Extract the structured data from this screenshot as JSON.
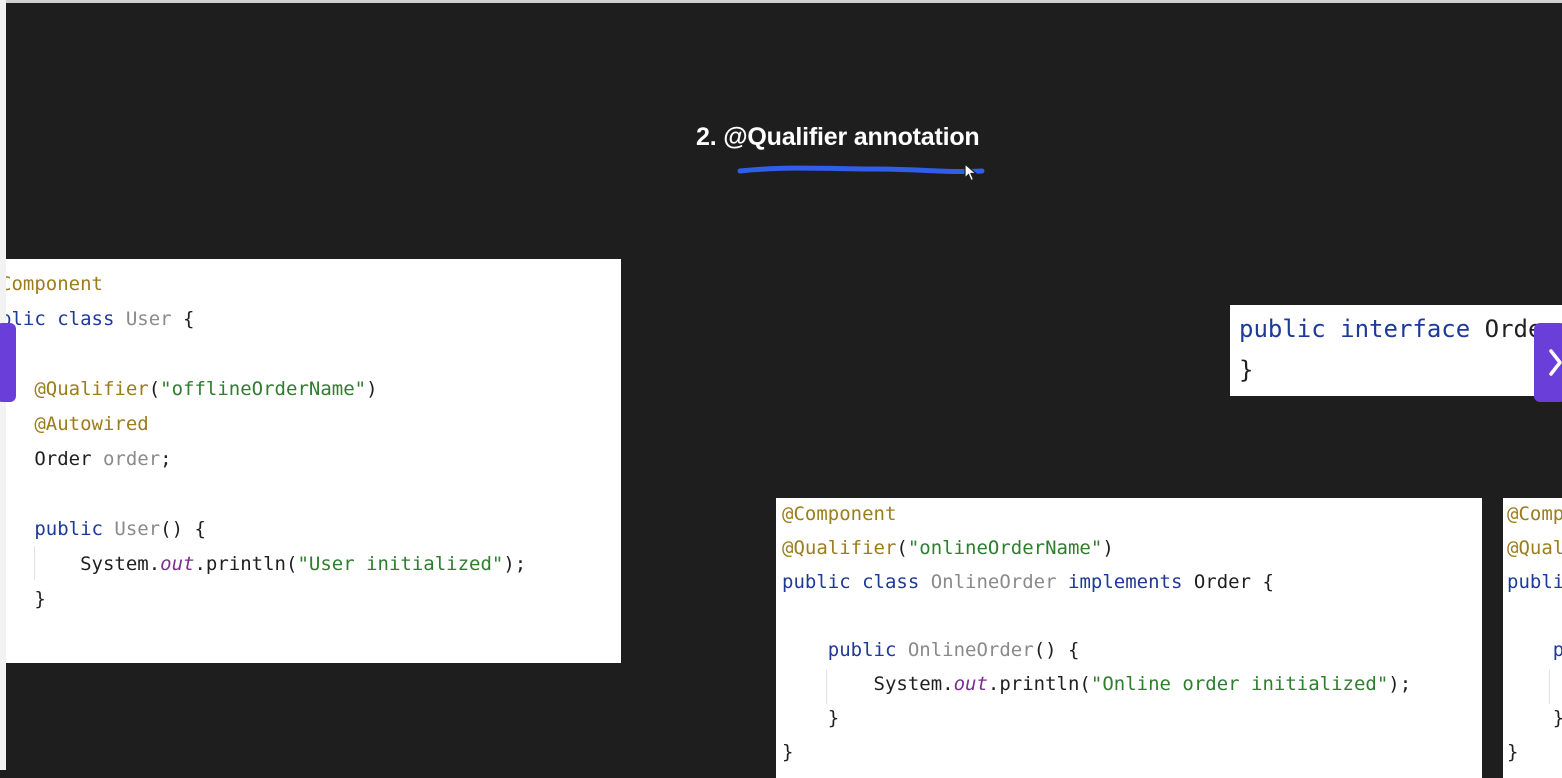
{
  "slide": {
    "title": "2.  @Qualifier annotation",
    "accent_color": "#2f5fe8"
  },
  "user_card": {
    "l1": "Component",
    "l2a": "blic ",
    "l2b": "class ",
    "l2c": "User",
    "l2d": " {",
    "l4a": "@Qualifier",
    "l4b": "(",
    "l4c": "\"offlineOrderName\"",
    "l4d": ")",
    "l5": "@Autowired",
    "l6a": "Order ",
    "l6b": "order",
    "l6c": ";",
    "l8a": "public ",
    "l8b": "User",
    "l8c": "() {",
    "l9a": "System.",
    "l9b": "out",
    "l9c": ".println(",
    "l9d": "\"User initialized\"",
    "l9e": ");",
    "l10": "}"
  },
  "interface_card": {
    "l1a": "public ",
    "l1b": "interface ",
    "l1c": "Orde",
    "l2": "}"
  },
  "online_card": {
    "l1": "@Component",
    "l2a": "@Qualifier",
    "l2b": "(",
    "l2c": "\"onlineOrderName\"",
    "l2d": ")",
    "l3a": "public ",
    "l3b": "class ",
    "l3c": "OnlineOrder ",
    "l3d": "implements ",
    "l3e": "Order {",
    "l5a": "public ",
    "l5b": "OnlineOrder",
    "l5c": "() {",
    "l6a": "System.",
    "l6b": "out",
    "l6c": ".println(",
    "l6d": "\"Online order initialized\"",
    "l6e": ");",
    "l7": "}",
    "l8": "}"
  },
  "partial_card": {
    "l1": "@Comp",
    "l2": "@Qual",
    "l3": "publi",
    "l5": "p",
    "l7": "}",
    "l8": "}"
  },
  "nav": {
    "prev_icon": "chevron-left-icon",
    "next_icon": "chevron-right-icon",
    "button_color": "#6a3fd9"
  }
}
